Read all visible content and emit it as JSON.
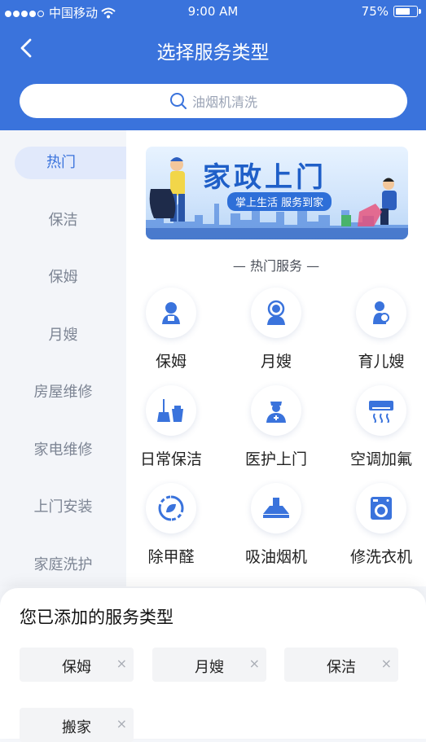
{
  "status": {
    "carrier": "中国移动",
    "time": "9:00 AM",
    "battery": "75%",
    "battery_level": 0.75
  },
  "nav": {
    "title": "选择服务类型"
  },
  "search": {
    "placeholder": "油烟机清洗"
  },
  "sidebar": {
    "items": [
      {
        "label": "热门",
        "active": true
      },
      {
        "label": "保洁"
      },
      {
        "label": "保姆"
      },
      {
        "label": "月嫂"
      },
      {
        "label": "房屋维修"
      },
      {
        "label": "家电维修"
      },
      {
        "label": "上门安装"
      },
      {
        "label": "家庭洗护"
      }
    ]
  },
  "banner": {
    "title": "家政上门",
    "subtitle": "掌上生活  服务到家"
  },
  "hot": {
    "title": "— 热门服务 —",
    "items": [
      {
        "label": "保姆",
        "icon": "nanny-icon"
      },
      {
        "label": "月嫂",
        "icon": "maternity-icon"
      },
      {
        "label": "育儿嫂",
        "icon": "childcare-icon"
      },
      {
        "label": "日常保洁",
        "icon": "cleaning-icon"
      },
      {
        "label": "医护上门",
        "icon": "medical-icon"
      },
      {
        "label": "空调加氟",
        "icon": "air-conditioner-icon"
      },
      {
        "label": "除甲醛",
        "icon": "formaldehyde-icon"
      },
      {
        "label": "吸油烟机",
        "icon": "range-hood-icon"
      },
      {
        "label": "修洗衣机",
        "icon": "washing-machine-icon"
      }
    ]
  },
  "added": {
    "title": "您已添加的服务类型",
    "tags": [
      "保姆",
      "月嫂",
      "保洁",
      "搬家"
    ],
    "remove": "×"
  },
  "colors": {
    "primary": "#3a73dc",
    "icon": "#3a73dc",
    "sidebar_bg": "#f3f5f9"
  }
}
